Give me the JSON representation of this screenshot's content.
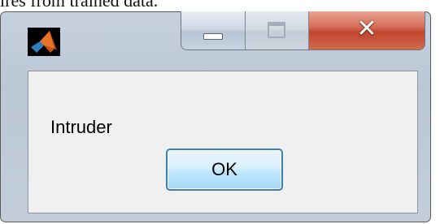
{
  "background_caption": "ires from trained data.",
  "window": {
    "app_icon": "matlab-logo-icon",
    "controls": {
      "minimize_icon": "minimize-icon",
      "maximize_icon": "maximize-icon",
      "close_icon": "close-icon",
      "close_glyph": "✕"
    }
  },
  "dialog": {
    "message": "Intruder",
    "ok_label": "OK"
  },
  "colors": {
    "close_button": "#c9533b",
    "ok_button_border": "#3c7fb1",
    "client_background": "#f0f0f0"
  }
}
